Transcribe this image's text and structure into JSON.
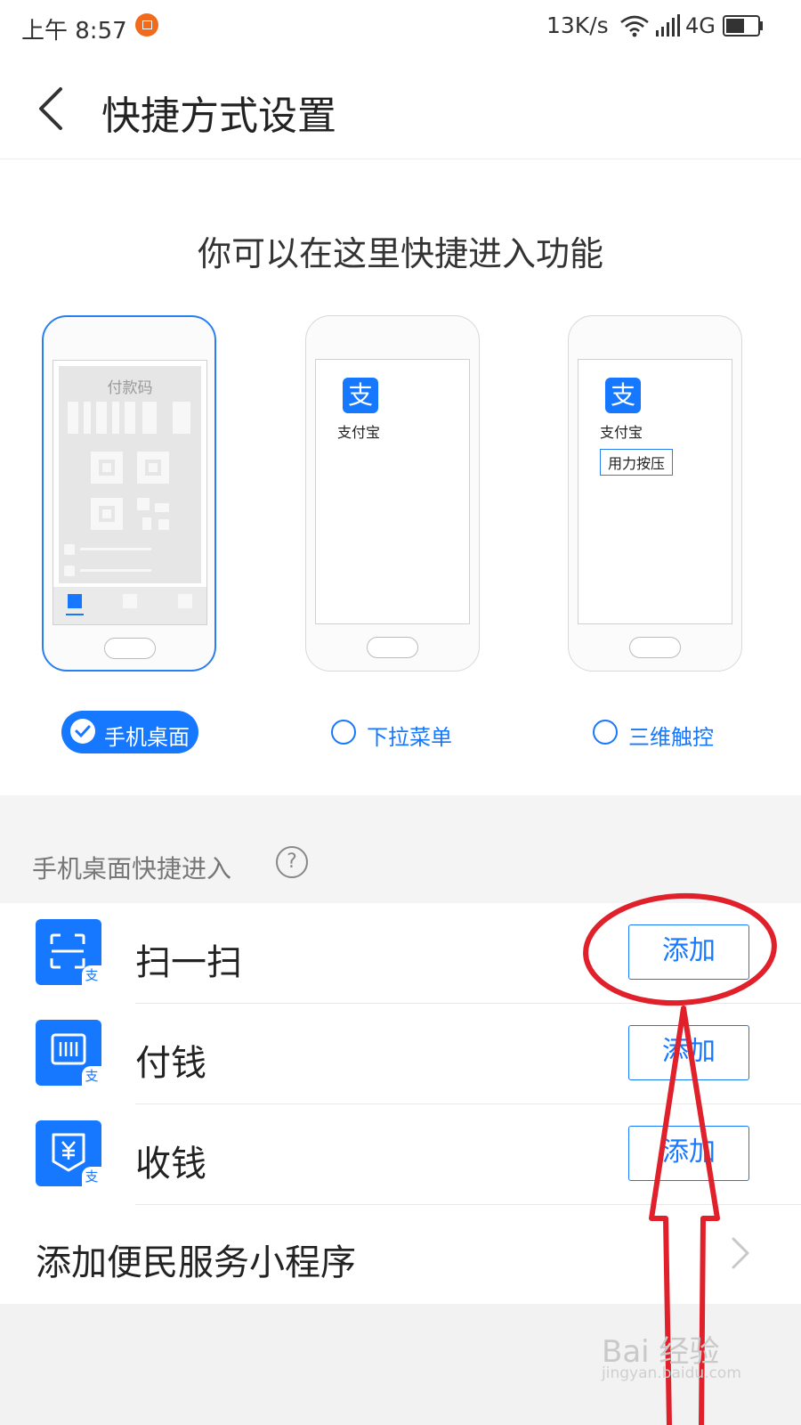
{
  "status_bar": {
    "time": "上午 8:57",
    "speed": "13K/s",
    "network": "4G",
    "icons": [
      "notification-icon",
      "wifi-icon",
      "signal-icon",
      "battery-icon"
    ]
  },
  "header": {
    "title": "快捷方式设置",
    "back_icon": "chevron-left-icon"
  },
  "intro": "你可以在这里快捷进入功能",
  "previews": {
    "home": {
      "caption": "付款码"
    },
    "dropdown": {
      "app_name": "支付宝",
      "app_glyph": "支"
    },
    "touch3d": {
      "app_name": "支付宝",
      "app_glyph": "支",
      "tip": "用力按压"
    }
  },
  "options": [
    {
      "label": "手机桌面",
      "selected": true
    },
    {
      "label": "下拉菜单",
      "selected": false
    },
    {
      "label": "三维触控",
      "selected": false
    }
  ],
  "section": {
    "title": "手机桌面快捷进入",
    "help": "?"
  },
  "shortcuts": [
    {
      "label": "扫一扫",
      "button": "添加",
      "icon": "scan-icon",
      "badge": "支"
    },
    {
      "label": "付钱",
      "button": "添加",
      "icon": "pay-icon",
      "badge": "支"
    },
    {
      "label": "收钱",
      "button": "添加",
      "icon": "receive-money-icon",
      "badge": "支"
    }
  ],
  "more": {
    "label": "添加便民服务小程序",
    "icon": "chevron-right-icon"
  },
  "watermark": {
    "brand": "Bai 经验",
    "url": "jingyan.baidu.com"
  },
  "colors": {
    "accent": "#1677ff",
    "annotation": "#e0202a"
  }
}
